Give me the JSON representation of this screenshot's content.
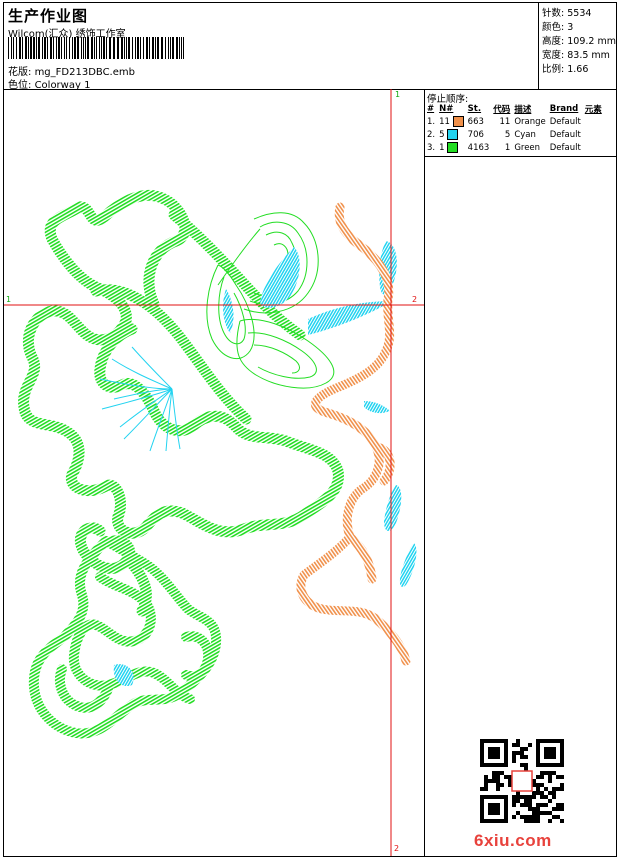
{
  "header": {
    "title": "生产作业图",
    "company": "Wilcom(汇众)  绣饰工作室",
    "design_label": "花版:",
    "design_file": "mg_FD213DBC.emb",
    "colorway_label": "色位:",
    "colorway": "Colorway 1"
  },
  "stats": {
    "stitches_label": "针数:",
    "stitches": "5534",
    "colors_label": "颜色:",
    "colors": "3",
    "height_label": "高度:",
    "height": "109.2 mm",
    "width_label": "宽度:",
    "width": "83.5 mm",
    "scale_label": "比例:",
    "scale": "1.66"
  },
  "stop_sequence": {
    "title": "停止顺序:",
    "headers": [
      "#",
      "N#",
      "St.",
      "代码",
      "描述",
      "Brand",
      "元素"
    ],
    "rows": [
      {
        "idx": "1.",
        "n": "11",
        "color": "#f0904a",
        "st": "663",
        "code": "11",
        "desc": "Orange",
        "brand": "Default"
      },
      {
        "idx": "2.",
        "n": "5",
        "color": "#22d3f0",
        "st": "706",
        "code": "5",
        "desc": "Cyan",
        "brand": "Default"
      },
      {
        "idx": "3.",
        "n": "1",
        "color": "#22dd22",
        "st": "4163",
        "code": "1",
        "desc": "Green",
        "brand": "Default"
      }
    ]
  },
  "canvas": {
    "axis_marks": [
      "1",
      "1",
      "2",
      "2"
    ]
  },
  "watermark": "6xiu.com",
  "colors": {
    "orange": "#f0904a",
    "cyan": "#22d3f0",
    "green": "#22dd22",
    "axis": "#e01010"
  }
}
